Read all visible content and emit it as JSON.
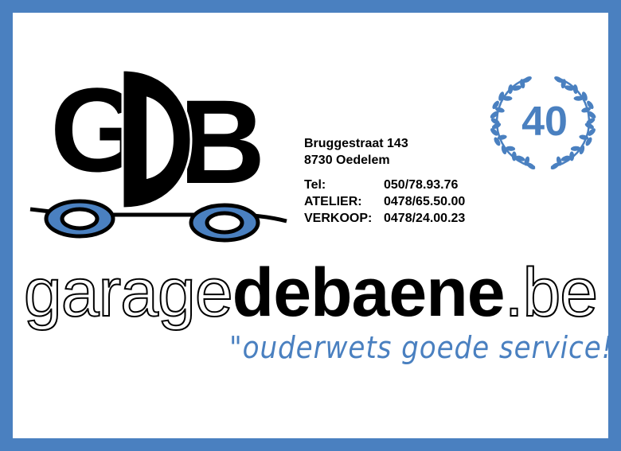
{
  "logo": {
    "letters": "GDB"
  },
  "address": {
    "street": "Bruggestraat 143",
    "city": "8730 Oedelem"
  },
  "contacts": [
    {
      "label": "Tel:",
      "number": "050/78.93.76"
    },
    {
      "label": "ATELIER:",
      "number": "0478/65.50.00"
    },
    {
      "label": "VERKOOP:",
      "number": "0478/24.00.23"
    }
  ],
  "anniversary": {
    "years": "40"
  },
  "domain": {
    "part1": "garage",
    "part2": "debaene",
    "part3": ".be"
  },
  "slogan": "\"ouderwets goede service!\"",
  "colors": {
    "brand_blue": "#4a80c0",
    "black": "#000000"
  }
}
